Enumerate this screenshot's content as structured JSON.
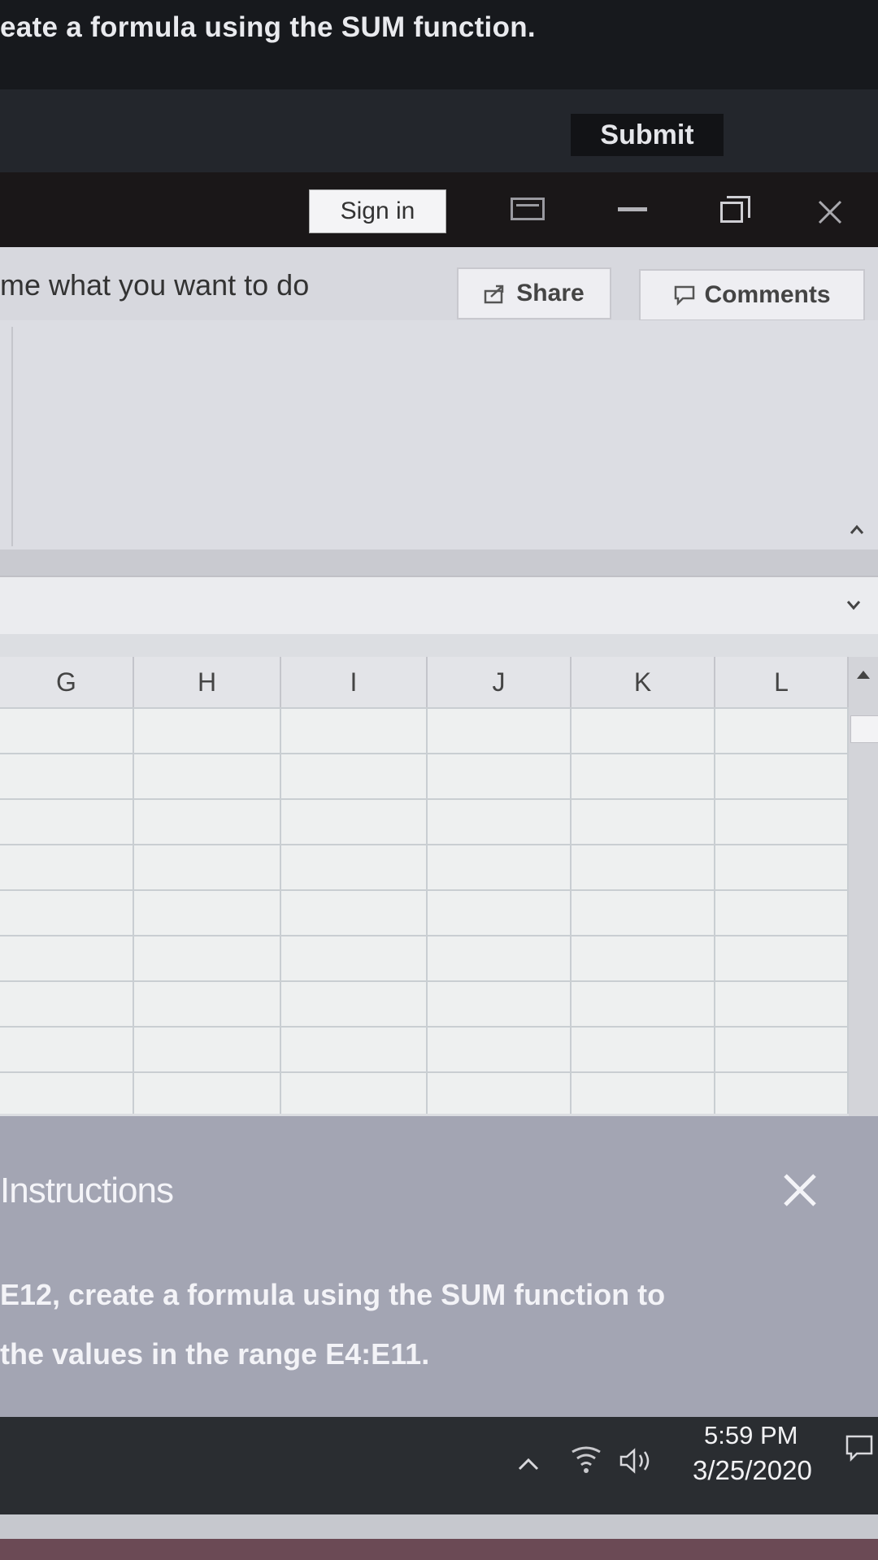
{
  "task": {
    "instruction_text": "eate a formula using the SUM function.",
    "submit_label": "Submit"
  },
  "titlebar": {
    "sign_in_label": "Sign in"
  },
  "ribbon_top": {
    "tell_me_text": "me what you want to do",
    "share_label": "Share",
    "comments_label": "Comments"
  },
  "sheet": {
    "columns": [
      "G",
      "H",
      "I",
      "J",
      "K",
      "L"
    ]
  },
  "instructions": {
    "title": "Instructions",
    "line1": "E12, create a formula using the SUM function to",
    "line2": "the values in the range E4:E11."
  },
  "taskbar": {
    "time": "5:59 PM",
    "date": "3/25/2020"
  }
}
